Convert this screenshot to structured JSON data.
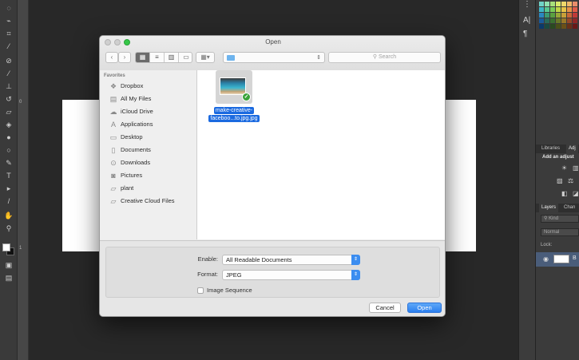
{
  "photoshop": {
    "ruler_ticks": [
      "0",
      "1"
    ],
    "panels": {
      "tabs_top": [
        "Libraries",
        "Adj"
      ],
      "adjust_title": "Add an adjust",
      "tabs_layers": [
        "Layers",
        "Chan"
      ],
      "kind_placeholder": "Kind",
      "blend_mode": "Normal",
      "lock_label": "Lock:",
      "layer_name": "B"
    },
    "panel_icons": {
      "a": "A|",
      "para": "¶"
    }
  },
  "dialog": {
    "title": "Open",
    "search_placeholder": "Search",
    "sidebar": {
      "heading": "Favorites",
      "items": [
        {
          "label": "Dropbox",
          "icon": "dropbox-icon"
        },
        {
          "label": "All My Files",
          "icon": "all-files-icon"
        },
        {
          "label": "iCloud Drive",
          "icon": "cloud-icon"
        },
        {
          "label": "Applications",
          "icon": "applications-icon"
        },
        {
          "label": "Desktop",
          "icon": "desktop-icon"
        },
        {
          "label": "Documents",
          "icon": "documents-icon"
        },
        {
          "label": "Downloads",
          "icon": "downloads-icon"
        },
        {
          "label": "Pictures",
          "icon": "pictures-icon"
        },
        {
          "label": "plant",
          "icon": "folder-icon"
        },
        {
          "label": "Creative Cloud Files",
          "icon": "folder-icon"
        }
      ]
    },
    "file": {
      "name_line1": "make-creative-",
      "name_line2": "faceboo...to.jpg.jpg"
    },
    "options": {
      "enable_label": "Enable:",
      "enable_value": "All Readable Documents",
      "format_label": "Format:",
      "format_value": "JPEG",
      "sequence_label": "Image Sequence"
    },
    "buttons": {
      "cancel": "Cancel",
      "open": "Open"
    }
  },
  "colors": {
    "accent": "#2b7fef",
    "selection": "#1b6ae0"
  }
}
